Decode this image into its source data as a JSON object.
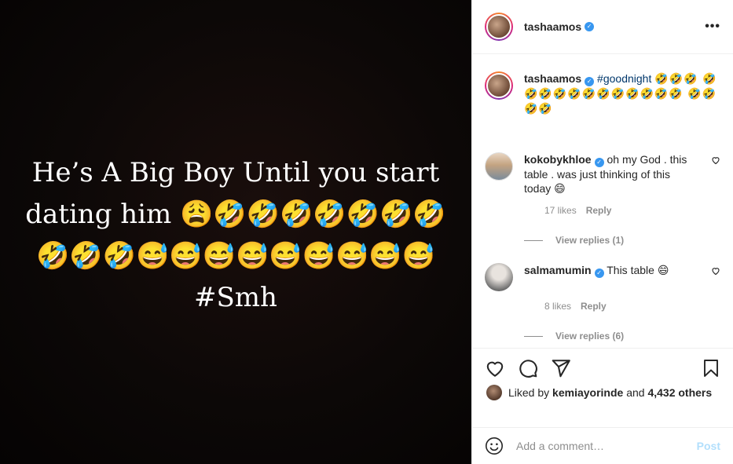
{
  "media": {
    "text": "He’s A Big Boy Until you start dating him 😩🤣🤣🤣🤣🤣🤣🤣🤣🤣🤣😅😅😅😅😅😅😅😅😅 #Smh"
  },
  "header": {
    "username": "tashaamos",
    "more_icon": "more-horizontal-icon",
    "more_label": "•••"
  },
  "caption": {
    "username": "tashaamos",
    "hashtag": "#goodnight",
    "emojis": "🤣🤣🤣 🤣🤣🤣🤣🤣🤣🤣🤣🤣🤣🤣🤣 🤣🤣🤣🤣"
  },
  "comments": [
    {
      "username": "kokobykhloe",
      "text": "oh my God . this table . was just thinking of this today 😄",
      "likes": "17 likes",
      "reply": "Reply",
      "view_replies": "View replies (1)"
    },
    {
      "username": "salmamumin",
      "text": "This table 😄",
      "likes": "8 likes",
      "reply": "Reply",
      "view_replies": "View replies (6)"
    }
  ],
  "likes": {
    "prefix": "Liked by ",
    "user": "kemiayorinde",
    "middle": " and ",
    "count": "4,432 others"
  },
  "add_comment": {
    "placeholder": "Add a comment…",
    "post_label": "Post"
  },
  "colors": {
    "link": "#00376b",
    "verified": "#3897f0",
    "muted": "#8e8e8e",
    "post_disabled": "#b2dffc"
  }
}
